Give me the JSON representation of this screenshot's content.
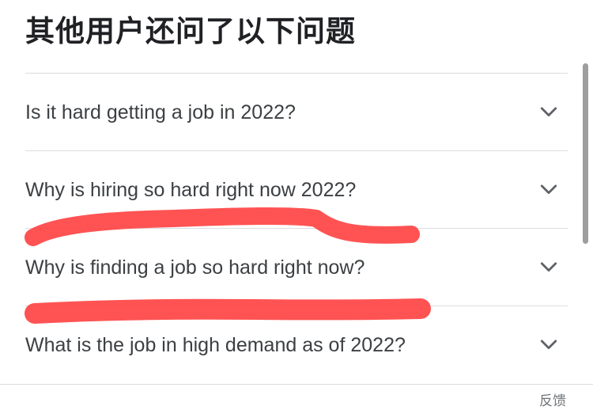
{
  "section": {
    "title": "其他用户还问了以下问题"
  },
  "questions": [
    {
      "label": "Is it hard getting a job in 2022?"
    },
    {
      "label": "Why is hiring so hard right now 2022?"
    },
    {
      "label": "Why is finding a job so hard right now?"
    },
    {
      "label": "What is the job in high demand as of 2022?"
    }
  ],
  "footer": {
    "feedback_label": "反馈"
  },
  "icons": {
    "expand": "chevron-down-icon"
  },
  "colors": {
    "annotation": "#ff3b3b",
    "chevron": "#5f6368",
    "divider": "#dadce0"
  }
}
